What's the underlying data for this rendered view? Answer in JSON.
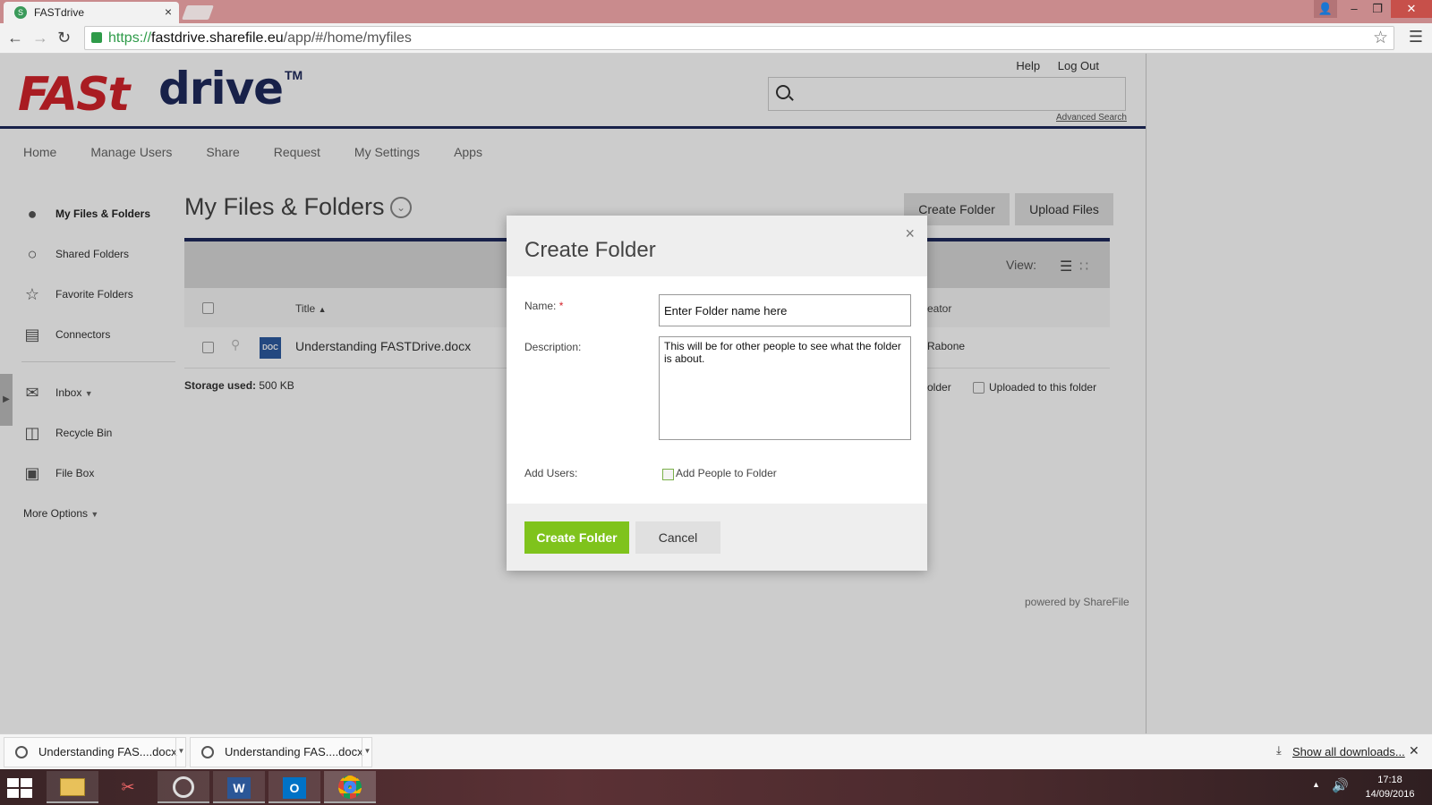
{
  "browser": {
    "tab_title": "FASTdrive",
    "tab_close": "×",
    "url_scheme": "https://",
    "url_host": "fastdrive.sharefile.eu",
    "url_path": "/app/#/home/myfiles",
    "back_icon": "arrow-left-icon",
    "forward_icon": "arrow-right-icon",
    "reload_icon": "reload-icon",
    "star_icon": "☆",
    "menu_icon": "☰"
  },
  "window_controls": {
    "minimize": "–",
    "maximize": "❐",
    "close": "✕",
    "user": "👤"
  },
  "site": {
    "logo_fast": "FASt",
    "logo_drive": "drive",
    "logo_tm": "TM",
    "help": "Help",
    "logout": "Log Out",
    "search_placeholder": "",
    "advanced_search": "Advanced Search",
    "nav": [
      "Home",
      "Manage Users",
      "Share",
      "Request",
      "My Settings",
      "Apps"
    ],
    "brand_red": "#d4232b",
    "brand_navy": "#1f2a5c"
  },
  "sidebar": {
    "items": [
      {
        "label": "My Files & Folders",
        "icon": "user-icon"
      },
      {
        "label": "Shared Folders",
        "icon": "users-icon"
      },
      {
        "label": "Favorite Folders",
        "icon": "star-icon"
      },
      {
        "label": "Connectors",
        "icon": "connector-icon"
      },
      {
        "label": "Inbox",
        "icon": "mail-icon"
      },
      {
        "label": "Recycle Bin",
        "icon": "trash-icon"
      },
      {
        "label": "File Box",
        "icon": "inbox-tray-icon"
      }
    ],
    "more_options": "More Options"
  },
  "main": {
    "title": "My Files & Folders",
    "create_folder": "Create Folder",
    "upload_files": "Upload Files",
    "view_label": "View:",
    "columns": {
      "title": "Title",
      "creator": "eator"
    },
    "rows": [
      {
        "doc_type": "DOC",
        "title": "Understanding FASTDrive.docx",
        "creator": "Rabone"
      }
    ],
    "storage_label": "Storage used:",
    "storage_value": "500 KB",
    "filter_left": "older",
    "filter_right": "Uploaded to this folder",
    "powered_by": "powered by ShareFile"
  },
  "modal": {
    "title": "Create Folder",
    "close": "×",
    "name_label": "Name:",
    "required_mark": "*",
    "name_value": "Enter Folder name here",
    "description_label": "Description:",
    "description_value": "This will be for other people to see what the folder is about.",
    "add_users_label": "Add Users:",
    "add_people": "Add People to Folder",
    "create_button": "Create Folder",
    "cancel_button": "Cancel",
    "accent_green": "#7fc31c"
  },
  "downloads": {
    "items": [
      "Understanding FAS....docx",
      "Understanding FAS....docx"
    ],
    "show_all": "Show all downloads...",
    "close": "✕"
  },
  "taskbar": {
    "apps": [
      "file-explorer-icon",
      "snipping-tool-icon",
      "sharefile-sync-icon",
      "word-icon",
      "outlook-icon",
      "chrome-icon"
    ],
    "time": "17:18",
    "date": "14/09/2016"
  }
}
